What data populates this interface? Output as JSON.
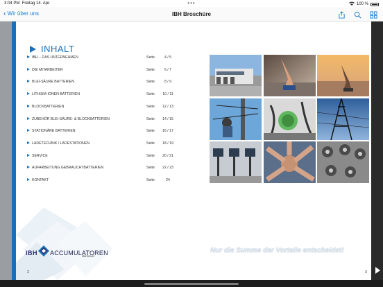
{
  "status": {
    "time": "3:04 PM",
    "date": "Freitag 14. Apr.",
    "battery": "100 %",
    "dots": "•••"
  },
  "nav": {
    "back_label": "Wir über uns",
    "title": "IBH Broschüre"
  },
  "page": {
    "heading": "INHALT",
    "toc": [
      {
        "label": "IBH – DAS UNTERNEHMEN",
        "seite": "Seite",
        "pages": "4 / 5"
      },
      {
        "label": "DIE MITARBEITER",
        "seite": "Seite",
        "pages": "6 / 7"
      },
      {
        "label": "BLEI-SÄURE BATTERIEN",
        "seite": "Seite",
        "pages": "8 / 9"
      },
      {
        "label": "LITHIUM-IONEN BATTERIEN",
        "seite": "Seite",
        "pages": "10 / 11"
      },
      {
        "label": "BLOCKBATTERIEN",
        "seite": "Seite",
        "pages": "12 / 13"
      },
      {
        "label": "ZUBEHÖR BLEI-SÄURE- & BLOCKBATTERIEN",
        "seite": "Seite",
        "pages": "14 / 15"
      },
      {
        "label": "STATIONÄRE BATTERIEN",
        "seite": "Seite",
        "pages": "16 / 17"
      },
      {
        "label": "LADETECHNIK / LADESTATIONEN",
        "seite": "Seite",
        "pages": "18 / 19"
      },
      {
        "label": "SERVICE",
        "seite": "Seite",
        "pages": "20 / 21"
      },
      {
        "label": "AUFARBEITUNG GEBRAUCHTBATTERIEN",
        "seite": "Seite",
        "pages": "22 / 23"
      },
      {
        "label": "KONTAKT",
        "seite": "Seite",
        "pages": "24"
      }
    ],
    "logo": {
      "ibh": "IBH",
      "accumulatoren": "ACCUMULATOREN",
      "city": "Hannover"
    },
    "slogan": "Nur die Summe der Vorteile entscheidet!",
    "page_left": "2",
    "page_right": "3"
  },
  "colors": {
    "accent": "#1a6fb8",
    "nav_link": "#1a7bd0"
  },
  "icons": [
    "share-icon",
    "search-icon",
    "grid-icon",
    "next-page-icon"
  ]
}
